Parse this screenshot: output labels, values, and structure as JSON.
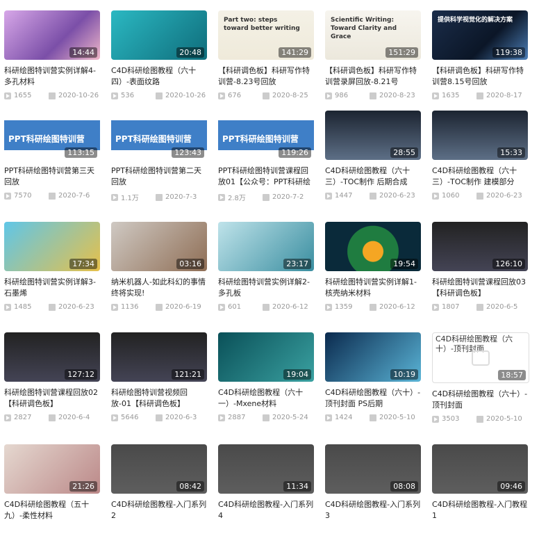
{
  "videos": [
    {
      "title": "科研绘图特训营实例详解4-多孔材料",
      "duration": "14:44",
      "views": "1655",
      "date": "2020-10-26",
      "thumb": "pink"
    },
    {
      "title": "C4D科研绘图教程（六十四）-表面纹路",
      "duration": "20:48",
      "views": "536",
      "date": "2020-10-26",
      "thumb": "teal"
    },
    {
      "title": "【科研调色板】科研写作特训营-8.23号回放",
      "duration": "141:29",
      "views": "676",
      "date": "2020-8-25",
      "thumb": "slide",
      "slide_text": "Part two: steps toward better writing"
    },
    {
      "title": "【科研调色板】科研写作特训营录屏回放-8.21号",
      "duration": "151:29",
      "views": "986",
      "date": "2020-8-23",
      "thumb": "slide2",
      "slide_text": "Scientific Writing: Toward Clarity and Grace"
    },
    {
      "title": "【科研调色板】科研写作特训营8.15号回放",
      "duration": "119:38",
      "views": "1635",
      "date": "2020-8-17",
      "thumb": "dark",
      "slide_text": "提供科学视觉化的解决方案"
    },
    {
      "title": "PPT科研绘图特训营第三天回放",
      "duration": "113:15",
      "views": "7570",
      "date": "2020-7-6",
      "thumb": "ppt",
      "slide_text": "PPT科研绘图特训营"
    },
    {
      "title": "PPT科研绘图特训营第二天回放",
      "duration": "123:43",
      "views": "1.1万",
      "date": "2020-7-3",
      "thumb": "ppt",
      "slide_text": "PPT科研绘图特训营"
    },
    {
      "title": "PPT科研绘图特训营课程回放01【公众号：PPT科研绘图】",
      "duration": "119:26",
      "views": "2.8万",
      "date": "2020-7-2",
      "thumb": "ppt",
      "slide_text": "PPT科研绘图特训营"
    },
    {
      "title": "C4D科研绘图教程（六十三）-TOC制作 后期合成",
      "duration": "28:55",
      "views": "1447",
      "date": "2020-6-23",
      "thumb": "lightning"
    },
    {
      "title": "C4D科研绘图教程（六十三）-TOC制作 建模部分",
      "duration": "15:33",
      "views": "1060",
      "date": "2020-6-23",
      "thumb": "lightning"
    },
    {
      "title": "科研绘图特训营实例详解3-石墨烯",
      "duration": "17:34",
      "views": "1485",
      "date": "2020-6-23",
      "thumb": "graphene"
    },
    {
      "title": "纳米机器人-如此科幻的事情终将实现!",
      "duration": "03:16",
      "views": "1136",
      "date": "2020-6-19",
      "thumb": "nano"
    },
    {
      "title": "科研绘图特训营实例详解2-多孔板",
      "duration": "23:17",
      "views": "601",
      "date": "2020-6-12",
      "thumb": "plate"
    },
    {
      "title": "科研绘图特训营实例详解1-核壳纳米材料",
      "duration": "19:54",
      "views": "1359",
      "date": "2020-6-12",
      "thumb": "sphere"
    },
    {
      "title": "科研绘图特训营课程回放03【科研调色板】",
      "duration": "126:10",
      "views": "1807",
      "date": "2020-6-5",
      "thumb": "screen"
    },
    {
      "title": "科研绘图特训营课程回放02【科研调色板】",
      "duration": "127:12",
      "views": "2827",
      "date": "2020-6-4",
      "thumb": "screen"
    },
    {
      "title": "科研绘图特训营视频回放-01【科研调色板】",
      "duration": "121:21",
      "views": "5646",
      "date": "2020-6-3",
      "thumb": "screen"
    },
    {
      "title": "C4D科研绘图教程（六十一）-Mxene材料",
      "duration": "19:04",
      "views": "2887",
      "date": "2020-5-24",
      "thumb": "mxene"
    },
    {
      "title": "C4D科研绘图教程（六十）-顶刊封面 PS后期",
      "duration": "10:19",
      "views": "1424",
      "date": "2020-5-10",
      "thumb": "balls"
    },
    {
      "title": "C4D科研绘图教程（六十）-顶刊封面",
      "duration": "18:57",
      "views": "3503",
      "date": "2020-5-10",
      "thumb": "broken",
      "alt": "C4D科研绘图教程（六十）-顶刊封面"
    },
    {
      "title": "C4D科研绘图教程（五十九）-柔性材料",
      "duration": "21:26",
      "views": "",
      "date": "",
      "thumb": "flex"
    },
    {
      "title": "C4D科研绘图教程-入门系列2",
      "duration": "08:42",
      "views": "",
      "date": "",
      "thumb": "c4d"
    },
    {
      "title": "C4D科研绘图教程-入门系列4",
      "duration": "11:34",
      "views": "",
      "date": "",
      "thumb": "c4d"
    },
    {
      "title": "C4D科研绘图教程-入门系列3",
      "duration": "08:08",
      "views": "",
      "date": "",
      "thumb": "c4d"
    },
    {
      "title": "C4D科研绘图教程-入门教程1",
      "duration": "09:46",
      "views": "",
      "date": "",
      "thumb": "c4d"
    }
  ]
}
